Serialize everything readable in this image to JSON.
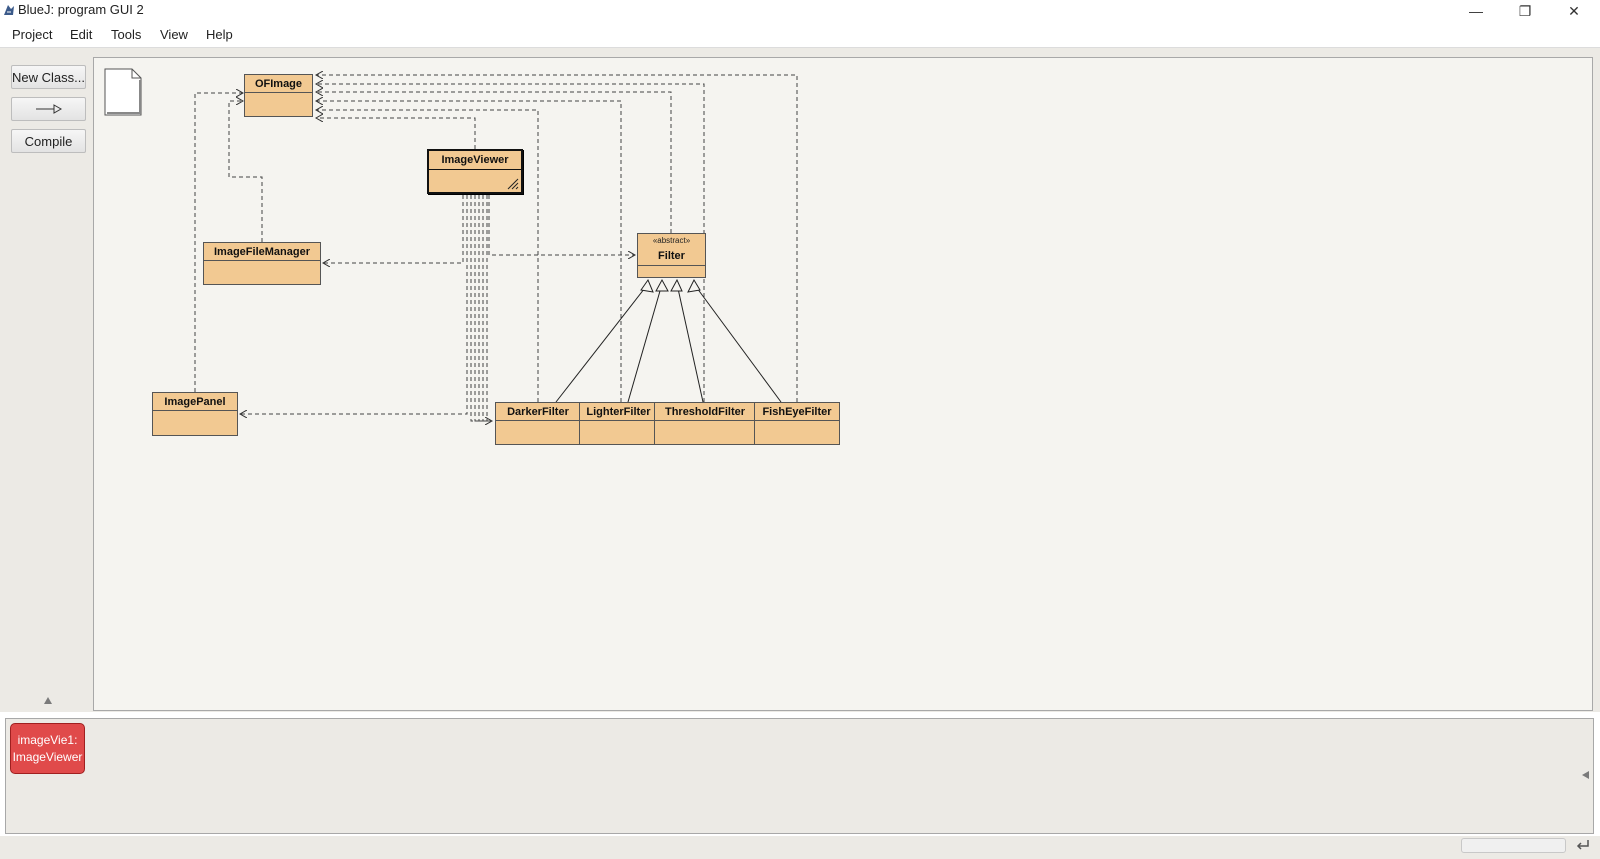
{
  "window": {
    "title": "BlueJ:  program GUI 2",
    "minimize_glyph": "—",
    "maximize_glyph": "❐",
    "close_glyph": "✕"
  },
  "menu": {
    "items": [
      "Project",
      "Edit",
      "Tools",
      "View",
      "Help"
    ]
  },
  "toolbar": {
    "new_class_label": "New Class...",
    "arrow_glyph": "—▷",
    "compile_label": "Compile"
  },
  "diagram": {
    "classes": {
      "ofimage": {
        "name": "OFImage"
      },
      "imageviewer": {
        "name": "ImageViewer"
      },
      "imagefilemanager": {
        "name": "ImageFileManager"
      },
      "filter": {
        "name": "Filter",
        "stereotype": "«abstract»"
      },
      "imagepanel": {
        "name": "ImagePanel"
      },
      "darkerfilter": {
        "name": "DarkerFilter"
      },
      "lighterfilter": {
        "name": "LighterFilter"
      },
      "thresholdfilter": {
        "name": "ThresholdFilter"
      },
      "fisheyefilter": {
        "name": "FishEyeFilter"
      }
    }
  },
  "bench": {
    "object": {
      "line1": "imageVie1:",
      "line2": "ImageViewer"
    }
  },
  "colors": {
    "class_fill": "#f2c992",
    "object_fill": "#e04a4a",
    "canvas_bg": "#f5f4f0"
  }
}
